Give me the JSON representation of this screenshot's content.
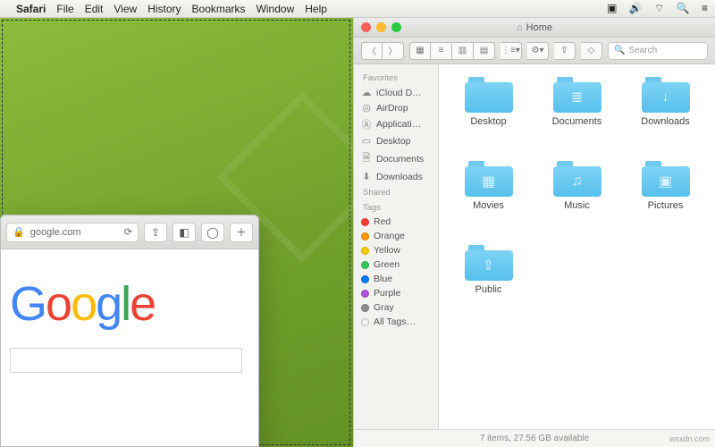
{
  "menubar": {
    "app": "Safari",
    "items": [
      "File",
      "Edit",
      "View",
      "History",
      "Bookmarks",
      "Window",
      "Help"
    ]
  },
  "safari": {
    "url_host": "google.com",
    "logo_letters": [
      "G",
      "o",
      "o",
      "g",
      "l",
      "e"
    ]
  },
  "finder": {
    "title": "Home",
    "search_placeholder": "Search",
    "sidebar": {
      "favorites_label": "Favorites",
      "favorites": [
        {
          "icon": "cloud",
          "label": "iCloud D…"
        },
        {
          "icon": "airdrop",
          "label": "AirDrop"
        },
        {
          "icon": "apps",
          "label": "Applicati…"
        },
        {
          "icon": "desktop",
          "label": "Desktop"
        },
        {
          "icon": "doc",
          "label": "Documents"
        },
        {
          "icon": "download",
          "label": "Downloads"
        }
      ],
      "shared_label": "Shared",
      "tags_label": "Tags",
      "tags": [
        {
          "color": "#ff3b30",
          "label": "Red"
        },
        {
          "color": "#ff9500",
          "label": "Orange"
        },
        {
          "color": "#ffcc00",
          "label": "Yellow"
        },
        {
          "color": "#34c759",
          "label": "Green"
        },
        {
          "color": "#007aff",
          "label": "Blue"
        },
        {
          "color": "#af52de",
          "label": "Purple"
        },
        {
          "color": "#8e8e93",
          "label": "Gray"
        },
        {
          "color": "transparent",
          "label": "All Tags…"
        }
      ]
    },
    "folders": [
      {
        "name": "Desktop",
        "glyph": ""
      },
      {
        "name": "Documents",
        "glyph": "≣"
      },
      {
        "name": "Downloads",
        "glyph": "↓"
      },
      {
        "name": "Movies",
        "glyph": "▦"
      },
      {
        "name": "Music",
        "glyph": "♫"
      },
      {
        "name": "Pictures",
        "glyph": "▣"
      },
      {
        "name": "Public",
        "glyph": "⇪"
      }
    ],
    "status": "7 items, 27.56 GB available"
  },
  "watermark": "wsxdn.com"
}
